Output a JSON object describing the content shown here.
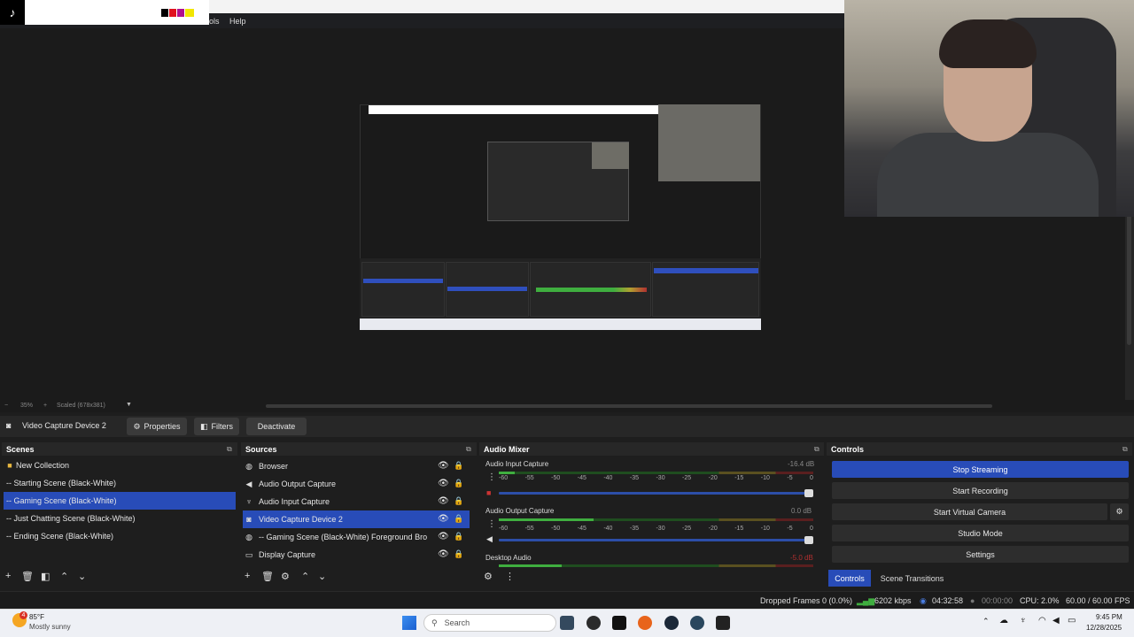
{
  "menubar": {
    "tools_partial": "ols",
    "help": "Help"
  },
  "preview": {
    "zoom": "35%",
    "scale_label": "Scaled (678x381)"
  },
  "source_toolbar": {
    "selected_source": "Video Capture Device 2",
    "properties": "Properties",
    "filters": "Filters",
    "deactivate": "Deactivate"
  },
  "scenes": {
    "title": "Scenes",
    "items": [
      {
        "label": "New Collection",
        "icon": "folder-icon"
      },
      {
        "label": "-- Starting Scene (Black-White)"
      },
      {
        "label": "-- Gaming Scene (Black-White)",
        "selected": true
      },
      {
        "label": "-- Just Chatting Scene (Black-White)"
      },
      {
        "label": "-- Ending Scene (Black-White)"
      }
    ]
  },
  "sources": {
    "title": "Sources",
    "items": [
      {
        "label": "Browser",
        "icon": "globe-icon"
      },
      {
        "label": "Audio Output Capture",
        "icon": "speaker-icon"
      },
      {
        "label": "Audio Input Capture",
        "icon": "microphone-icon"
      },
      {
        "label": "Video Capture Device 2",
        "icon": "camera-icon",
        "selected": true
      },
      {
        "label": "-- Gaming Scene (Black-White)  Foreground Browse",
        "icon": "globe-icon"
      },
      {
        "label": "Display Capture",
        "icon": "monitor-icon"
      }
    ]
  },
  "mixer": {
    "title": "Audio Mixer",
    "ticks": [
      "-60",
      "-55",
      "-50",
      "-45",
      "-40",
      "-35",
      "-30",
      "-25",
      "-20",
      "-15",
      "-10",
      "-5",
      "0"
    ],
    "channels": [
      {
        "name": "Audio Input Capture",
        "db": "-16.4 dB",
        "level": 0.05,
        "fader": 0.99
      },
      {
        "name": "Audio Output Capture",
        "db": "0.0 dB",
        "level": 0.3,
        "fader": 0.99
      },
      {
        "name": "Desktop Audio",
        "db": "-5.0 dB",
        "level": 0.2,
        "fader": 0.9
      }
    ]
  },
  "controls": {
    "title": "Controls",
    "stop_streaming": "Stop Streaming",
    "start_recording": "Start Recording",
    "start_virtual_camera": "Start Virtual Camera",
    "studio_mode": "Studio Mode",
    "settings": "Settings",
    "tab_controls": "Controls",
    "tab_scene_transitions": "Scene Transitions"
  },
  "status": {
    "dropped_frames": "Dropped Frames 0 (0.0%)",
    "bitrate": "6202 kbps",
    "stream_time": "04:32:58",
    "record_time": "00:00:00",
    "cpu": "CPU: 2.0%",
    "fps": "60.00 / 60.00 FPS"
  },
  "taskbar": {
    "weather_temp": "85°F",
    "weather_desc": "Mostly sunny",
    "weather_badge": "4",
    "search": "Search",
    "time": "9:45 PM",
    "date": "12/28/2025"
  },
  "colors": {
    "accent": "#284cb8",
    "swatches": [
      "#000000",
      "#e0101e",
      "#b0108e",
      "#f2e600"
    ]
  }
}
